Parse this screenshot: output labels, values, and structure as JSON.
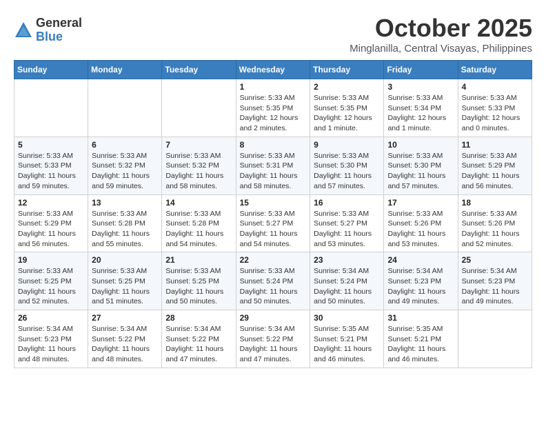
{
  "logo": {
    "general": "General",
    "blue": "Blue"
  },
  "header": {
    "month": "October 2025",
    "location": "Minglanilla, Central Visayas, Philippines"
  },
  "days_of_week": [
    "Sunday",
    "Monday",
    "Tuesday",
    "Wednesday",
    "Thursday",
    "Friday",
    "Saturday"
  ],
  "weeks": [
    [
      {
        "day": "",
        "info": ""
      },
      {
        "day": "",
        "info": ""
      },
      {
        "day": "",
        "info": ""
      },
      {
        "day": "1",
        "info": "Sunrise: 5:33 AM\nSunset: 5:35 PM\nDaylight: 12 hours\nand 2 minutes."
      },
      {
        "day": "2",
        "info": "Sunrise: 5:33 AM\nSunset: 5:35 PM\nDaylight: 12 hours\nand 1 minute."
      },
      {
        "day": "3",
        "info": "Sunrise: 5:33 AM\nSunset: 5:34 PM\nDaylight: 12 hours\nand 1 minute."
      },
      {
        "day": "4",
        "info": "Sunrise: 5:33 AM\nSunset: 5:33 PM\nDaylight: 12 hours\nand 0 minutes."
      }
    ],
    [
      {
        "day": "5",
        "info": "Sunrise: 5:33 AM\nSunset: 5:33 PM\nDaylight: 11 hours\nand 59 minutes."
      },
      {
        "day": "6",
        "info": "Sunrise: 5:33 AM\nSunset: 5:32 PM\nDaylight: 11 hours\nand 59 minutes."
      },
      {
        "day": "7",
        "info": "Sunrise: 5:33 AM\nSunset: 5:32 PM\nDaylight: 11 hours\nand 58 minutes."
      },
      {
        "day": "8",
        "info": "Sunrise: 5:33 AM\nSunset: 5:31 PM\nDaylight: 11 hours\nand 58 minutes."
      },
      {
        "day": "9",
        "info": "Sunrise: 5:33 AM\nSunset: 5:30 PM\nDaylight: 11 hours\nand 57 minutes."
      },
      {
        "day": "10",
        "info": "Sunrise: 5:33 AM\nSunset: 5:30 PM\nDaylight: 11 hours\nand 57 minutes."
      },
      {
        "day": "11",
        "info": "Sunrise: 5:33 AM\nSunset: 5:29 PM\nDaylight: 11 hours\nand 56 minutes."
      }
    ],
    [
      {
        "day": "12",
        "info": "Sunrise: 5:33 AM\nSunset: 5:29 PM\nDaylight: 11 hours\nand 56 minutes."
      },
      {
        "day": "13",
        "info": "Sunrise: 5:33 AM\nSunset: 5:28 PM\nDaylight: 11 hours\nand 55 minutes."
      },
      {
        "day": "14",
        "info": "Sunrise: 5:33 AM\nSunset: 5:28 PM\nDaylight: 11 hours\nand 54 minutes."
      },
      {
        "day": "15",
        "info": "Sunrise: 5:33 AM\nSunset: 5:27 PM\nDaylight: 11 hours\nand 54 minutes."
      },
      {
        "day": "16",
        "info": "Sunrise: 5:33 AM\nSunset: 5:27 PM\nDaylight: 11 hours\nand 53 minutes."
      },
      {
        "day": "17",
        "info": "Sunrise: 5:33 AM\nSunset: 5:26 PM\nDaylight: 11 hours\nand 53 minutes."
      },
      {
        "day": "18",
        "info": "Sunrise: 5:33 AM\nSunset: 5:26 PM\nDaylight: 11 hours\nand 52 minutes."
      }
    ],
    [
      {
        "day": "19",
        "info": "Sunrise: 5:33 AM\nSunset: 5:25 PM\nDaylight: 11 hours\nand 52 minutes."
      },
      {
        "day": "20",
        "info": "Sunrise: 5:33 AM\nSunset: 5:25 PM\nDaylight: 11 hours\nand 51 minutes."
      },
      {
        "day": "21",
        "info": "Sunrise: 5:33 AM\nSunset: 5:25 PM\nDaylight: 11 hours\nand 50 minutes."
      },
      {
        "day": "22",
        "info": "Sunrise: 5:33 AM\nSunset: 5:24 PM\nDaylight: 11 hours\nand 50 minutes."
      },
      {
        "day": "23",
        "info": "Sunrise: 5:34 AM\nSunset: 5:24 PM\nDaylight: 11 hours\nand 50 minutes."
      },
      {
        "day": "24",
        "info": "Sunrise: 5:34 AM\nSunset: 5:23 PM\nDaylight: 11 hours\nand 49 minutes."
      },
      {
        "day": "25",
        "info": "Sunrise: 5:34 AM\nSunset: 5:23 PM\nDaylight: 11 hours\nand 49 minutes."
      }
    ],
    [
      {
        "day": "26",
        "info": "Sunrise: 5:34 AM\nSunset: 5:23 PM\nDaylight: 11 hours\nand 48 minutes."
      },
      {
        "day": "27",
        "info": "Sunrise: 5:34 AM\nSunset: 5:22 PM\nDaylight: 11 hours\nand 48 minutes."
      },
      {
        "day": "28",
        "info": "Sunrise: 5:34 AM\nSunset: 5:22 PM\nDaylight: 11 hours\nand 47 minutes."
      },
      {
        "day": "29",
        "info": "Sunrise: 5:34 AM\nSunset: 5:22 PM\nDaylight: 11 hours\nand 47 minutes."
      },
      {
        "day": "30",
        "info": "Sunrise: 5:35 AM\nSunset: 5:21 PM\nDaylight: 11 hours\nand 46 minutes."
      },
      {
        "day": "31",
        "info": "Sunrise: 5:35 AM\nSunset: 5:21 PM\nDaylight: 11 hours\nand 46 minutes."
      },
      {
        "day": "",
        "info": ""
      }
    ]
  ]
}
